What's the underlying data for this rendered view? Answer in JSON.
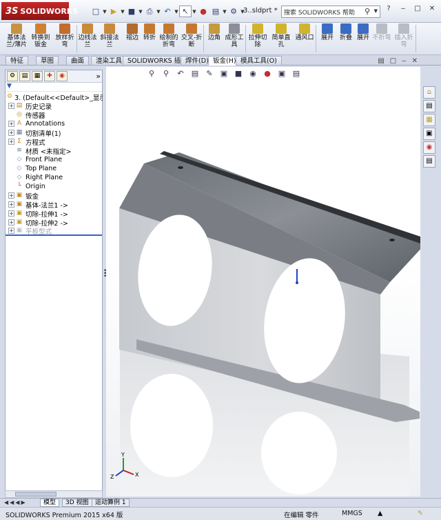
{
  "app": {
    "logo_text": "SOLIDWORKS",
    "logo_mark": "3S",
    "doc_title": "3..sldprt *"
  },
  "search": {
    "placeholder": "搜索 SOLIDWORKS 帮助"
  },
  "quick_access": [
    {
      "name": "new-icon",
      "glyph": "□"
    },
    {
      "name": "open-icon",
      "glyph": "▶"
    },
    {
      "name": "save-icon",
      "glyph": "■"
    },
    {
      "name": "print-icon",
      "glyph": "⎙"
    },
    {
      "name": "undo-icon",
      "glyph": "↶"
    },
    {
      "name": "select-icon",
      "glyph": "↖"
    },
    {
      "name": "traffic-light-icon",
      "glyph": "●"
    },
    {
      "name": "file-properties-icon",
      "glyph": "▤"
    },
    {
      "name": "options-icon",
      "glyph": "⚙"
    }
  ],
  "window_buttons": [
    "?",
    "‒",
    "□",
    "✕"
  ],
  "commands": [
    {
      "label": "基体法\n兰/薄片",
      "color": "#c99240"
    },
    {
      "label": "转换到\n钣金",
      "color": "#d08030"
    },
    {
      "label": "放样折\n弯",
      "color": "#c46c2c"
    },
    {
      "label": "边线法\n兰",
      "color": "#c98a3c"
    },
    {
      "label": "斜接法\n兰",
      "color": "#c98a3c"
    },
    {
      "label": "褶边",
      "color": "#b46b2e"
    },
    {
      "label": "转折",
      "color": "#c6782f"
    },
    {
      "label": "绘制的\n折弯",
      "color": "#c6782f"
    },
    {
      "label": "交叉-折\n断",
      "color": "#c6782f"
    },
    {
      "label": "边角",
      "color": "#c79a3c"
    },
    {
      "label": "成形工\n具",
      "color": "#8c8f9a"
    },
    {
      "label": "拉伸切\n除",
      "color": "#d2b42c"
    },
    {
      "label": "简单直\n孔",
      "color": "#d2b42c"
    },
    {
      "label": "通风口",
      "color": "#d2b42c"
    },
    {
      "label": "展开",
      "color": "#3b6cc4"
    },
    {
      "label": "折叠",
      "color": "#3b6cc4"
    },
    {
      "label": "展开",
      "color": "#3b6cc4"
    },
    {
      "label": "不折弯",
      "color": "#b8bcc4",
      "disabled": true
    },
    {
      "label": "插入折\n弯",
      "color": "#b8bcc4",
      "disabled": true
    }
  ],
  "tabs": [
    "特征",
    "草图",
    "曲面",
    "渲染工具",
    "SOLIDWORKS 插件",
    "焊件(D)",
    "钣金(H)",
    "模具工具(O)"
  ],
  "active_tab": 6,
  "tree": [
    {
      "label": "3.  (Default<<Default>_显示状",
      "icon": "part-icon",
      "glyph": "⚙",
      "color": "#c9a23a",
      "exp": "",
      "indent": 0
    },
    {
      "label": "历史记录",
      "icon": "history-icon",
      "glyph": "▤",
      "color": "#c08a2a",
      "exp": "+",
      "indent": 1
    },
    {
      "label": "传感器",
      "icon": "sensor-icon",
      "glyph": "◎",
      "color": "#c08a2a",
      "exp": "",
      "indent": 1
    },
    {
      "label": "Annotations",
      "icon": "annotations-icon",
      "glyph": "A",
      "color": "#c08a2a",
      "exp": "+",
      "indent": 1
    },
    {
      "label": "切割清单(1)",
      "icon": "cut-list-icon",
      "glyph": "▦",
      "color": "#6a7b94",
      "exp": "+",
      "indent": 1
    },
    {
      "label": "方程式",
      "icon": "equations-icon",
      "glyph": "Σ",
      "color": "#c08a2a",
      "exp": "+",
      "indent": 1
    },
    {
      "label": "材质 <未指定>",
      "icon": "material-icon",
      "glyph": "≡",
      "color": "#5a6f96",
      "exp": "",
      "indent": 1
    },
    {
      "label": "Front Plane",
      "icon": "plane-icon",
      "glyph": "◇",
      "color": "#7788aa",
      "exp": "",
      "indent": 1
    },
    {
      "label": "Top Plane",
      "icon": "plane-icon",
      "glyph": "◇",
      "color": "#7788aa",
      "exp": "",
      "indent": 1
    },
    {
      "label": "Right Plane",
      "icon": "plane-icon",
      "glyph": "◇",
      "color": "#7788aa",
      "exp": "",
      "indent": 1
    },
    {
      "label": "Origin",
      "icon": "origin-icon",
      "glyph": "└",
      "color": "#b03030",
      "exp": "",
      "indent": 1
    },
    {
      "label": "钣金",
      "icon": "sheet-metal-icon",
      "glyph": "▣",
      "color": "#c08a2a",
      "exp": "+",
      "indent": 1
    },
    {
      "label": "基体-法兰1 ->",
      "icon": "base-flange-icon",
      "glyph": "▣",
      "color": "#c08a2a",
      "exp": "+",
      "indent": 1
    },
    {
      "label": "切除-拉伸1 ->",
      "icon": "cut-extrude-icon",
      "glyph": "▣",
      "color": "#c0a02a",
      "exp": "+",
      "indent": 1
    },
    {
      "label": "切除-拉伸2 ->",
      "icon": "cut-extrude-icon",
      "glyph": "▣",
      "color": "#c0a02a",
      "exp": "+",
      "indent": 1
    },
    {
      "label": "平板型式",
      "icon": "flat-pattern-icon",
      "glyph": "▣",
      "color": "#b5bcc8",
      "exp": "+",
      "indent": 1,
      "dim": true
    }
  ],
  "filter_glyph": "▼",
  "bottom_tabs": [
    "模型",
    "3D 视图",
    "运动算例 1"
  ],
  "status": {
    "app_version": "SOLIDWORKS Premium 2015 x64 版",
    "editing": "在编辑 零件",
    "units": "MMGS"
  },
  "axes": {
    "x": "X",
    "y": "Y",
    "z": "Z"
  }
}
